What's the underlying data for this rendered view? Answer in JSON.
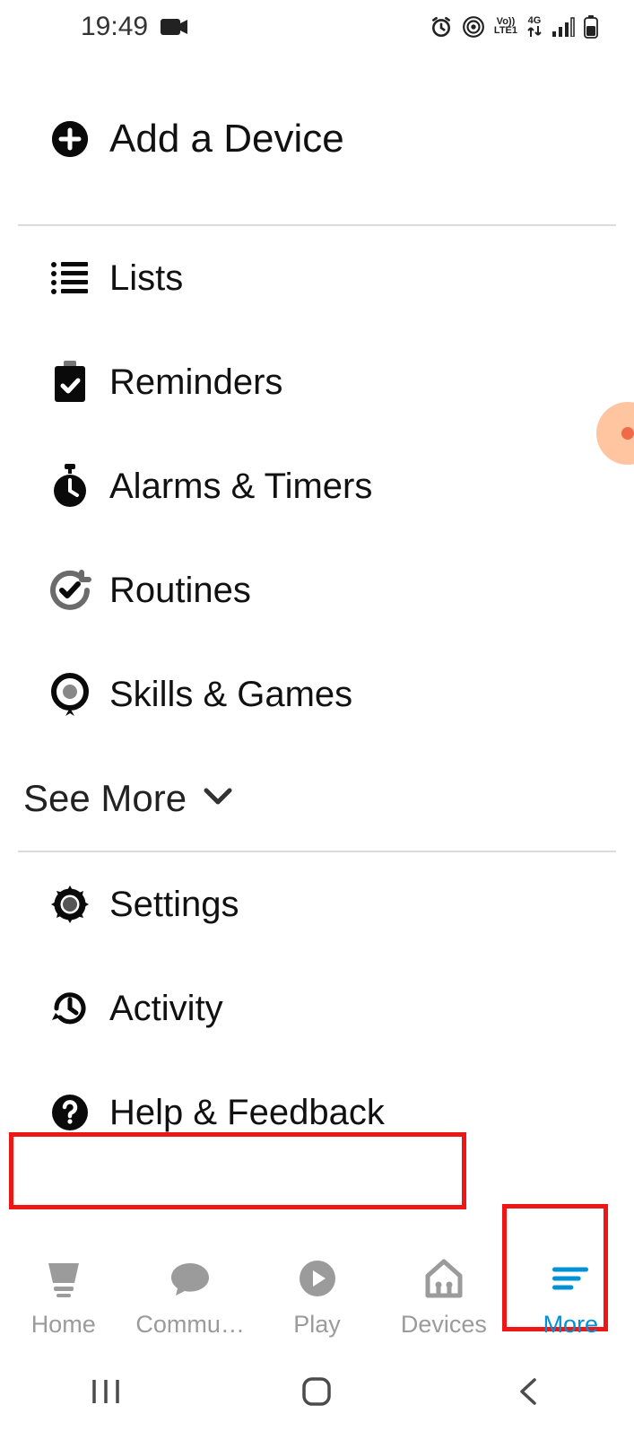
{
  "status": {
    "time": "19:49",
    "network_label_top": "Vo))",
    "network_label_bottom": "LTE1",
    "network_gen": "4G"
  },
  "menu": {
    "add_device": "Add a Device",
    "items": [
      {
        "label": "Lists"
      },
      {
        "label": "Reminders"
      },
      {
        "label": "Alarms & Timers"
      },
      {
        "label": "Routines"
      },
      {
        "label": "Skills & Games"
      }
    ],
    "see_more": "See More",
    "footer": [
      {
        "label": "Settings"
      },
      {
        "label": "Activity"
      },
      {
        "label": "Help & Feedback"
      }
    ]
  },
  "nav": {
    "items": [
      {
        "label": "Home"
      },
      {
        "label": "Commu…"
      },
      {
        "label": "Play"
      },
      {
        "label": "Devices"
      },
      {
        "label": "More"
      }
    ],
    "active_index": 4
  }
}
